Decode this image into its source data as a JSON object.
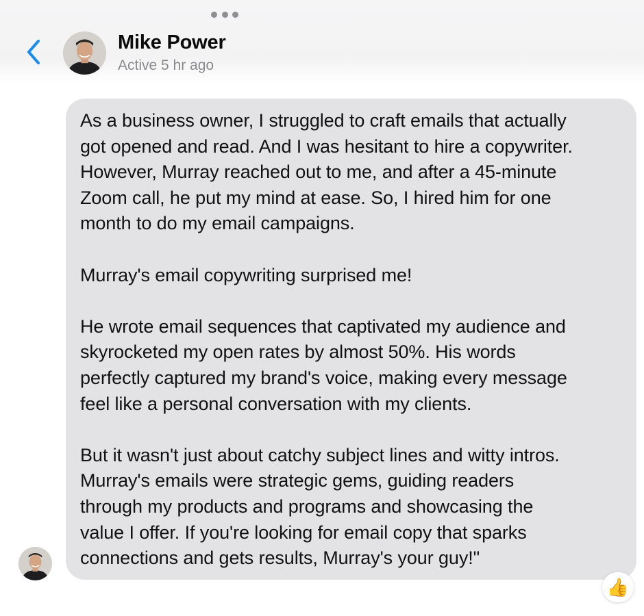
{
  "header": {
    "contact_name": "Mike Power",
    "status": "Active 5 hr ago",
    "back_icon": "chevron-left-icon",
    "accent_color": "#1a8cf0"
  },
  "message": {
    "paragraphs": [
      "As a business owner, I struggled to craft emails that actually\ngot opened and read. And I was hesitant to hire a copywriter.\nHowever, Murray reached out to me, and after a 45-minute\nZoom call, he put my mind at ease. So, I hired him for one\nmonth to do my email campaigns.",
      "Murray's email copywriting surprised me!",
      "He wrote email sequences that captivated my audience and\nskyrocketed my open rates by almost 50%. His words\nperfectly captured my brand's voice, making every message\nfeel like a personal conversation with my clients.",
      "But it wasn't just about catchy subject lines and witty intros.\nMurray's emails were strategic gems, guiding readers\nthrough my products and programs and showcasing the\nvalue I offer. If you're looking for email copy that sparks\nconnections and gets results, Murray's your guy!\""
    ],
    "bubble_color": "#e3e3e5",
    "reaction": "👍"
  }
}
